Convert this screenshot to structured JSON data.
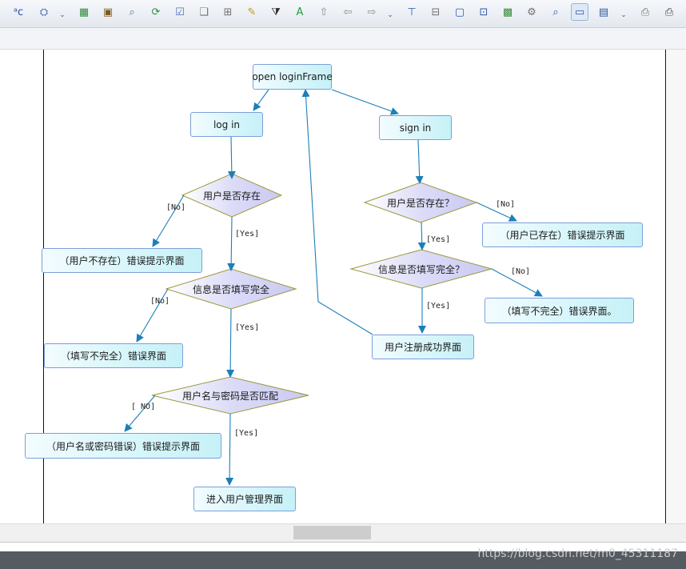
{
  "toolbar": {
    "buttons": [
      {
        "icon": "spell-check-icon",
        "glyph": "ᵃc",
        "color": "#2747a8"
      },
      {
        "icon": "shield-gear-icon",
        "glyph": "⛭",
        "color": "#4a6cb8"
      },
      {
        "icon": "notebook-icon",
        "glyph": "▦",
        "color": "#2f8a3a"
      },
      {
        "icon": "briefcase-icon",
        "glyph": "▣",
        "color": "#7a5a1e"
      },
      {
        "icon": "find-replace-icon",
        "glyph": "⌕",
        "color": "#5a6f9a"
      },
      {
        "icon": "refresh-icon",
        "glyph": "⟳",
        "color": "#2a8f3a"
      },
      {
        "icon": "checklist-icon",
        "glyph": "☑",
        "color": "#4a6cb8"
      },
      {
        "icon": "shadow-box-icon",
        "glyph": "❏",
        "color": "#707070"
      },
      {
        "icon": "align-grid-icon",
        "glyph": "⊞",
        "color": "#707070"
      },
      {
        "icon": "pencil-icon",
        "glyph": "✎",
        "color": "#c9961c"
      },
      {
        "icon": "paint-bucket-icon",
        "glyph": "⧩",
        "color": "#2e2e2e"
      },
      {
        "icon": "font-color-icon",
        "glyph": "A",
        "color": "#1f9e3a"
      },
      {
        "icon": "export-icon",
        "glyph": "⇧",
        "color": "#8a8a8a"
      },
      {
        "icon": "back-arrow-icon",
        "glyph": "⇦",
        "color": "#8a8a8a"
      },
      {
        "icon": "forward-arrow-icon",
        "glyph": "⇨",
        "color": "#8a8a8a"
      },
      {
        "icon": "class-diagram-icon",
        "glyph": "⊤",
        "color": "#2d55a6"
      },
      {
        "icon": "layout-icon",
        "glyph": "⊟",
        "color": "#707070"
      },
      {
        "icon": "page-icon",
        "glyph": "▢",
        "color": "#2d55a6"
      },
      {
        "icon": "component-icon",
        "glyph": "⊡",
        "color": "#2d55a6"
      },
      {
        "icon": "image-icon",
        "glyph": "▩",
        "color": "#3a8a3a"
      },
      {
        "icon": "settings-page-icon",
        "glyph": "⚙",
        "color": "#707070"
      },
      {
        "icon": "zoom-page-icon",
        "glyph": "⌕",
        "color": "#2d55a6"
      },
      {
        "icon": "comment-icon",
        "glyph": "▭",
        "color": "#2d55a6",
        "active": true
      },
      {
        "icon": "table-icon",
        "glyph": "▤",
        "color": "#2d55a6"
      },
      {
        "icon": "print-preview-icon",
        "glyph": "⎙",
        "color": "#707070"
      },
      {
        "icon": "printer-icon",
        "glyph": "⎙",
        "color": "#404040"
      }
    ],
    "overflow_glyph": "⌄"
  },
  "diagram": {
    "nodes": {
      "open_login": "open loginFrame",
      "log_in": "log in",
      "sign_in": "sign in",
      "user_not_exist_error": "（用户不存在）错误提示界面",
      "login_incomplete_error": "（填写不完全）错误界面",
      "credentials_error": "（用户名或密码错误）错误提示界面",
      "enter_admin": "进入用户管理界面",
      "user_exists_error": "（用户已存在）错误提示界面",
      "signup_incomplete_error": "（填写不完全）错误界面。",
      "register_success": "用户注册成功界面"
    },
    "decisions": {
      "login_user_exists": "用户是否存在",
      "login_info_complete": "信息是否填写完全",
      "credentials_match": "用户名与密码是否匹配",
      "signup_user_exists": "用户是否存在？",
      "signup_info_complete": "信息是否填写完全？"
    },
    "guards": {
      "no_1": "[No]",
      "yes_1": "[Yes]",
      "no_2": "[No]",
      "yes_2": "[Yes]",
      "no_3": "[ NO]",
      "yes_3": "[Yes]",
      "no_4": "[No]",
      "yes_4": "[Yes]",
      "no_5": "[No]",
      "yes_5": "[Yes]"
    },
    "colors": {
      "edge": "#1c7fb8",
      "node_border": "#7d9fd8",
      "node_fill": "#d8f6fb",
      "decision_fill": "#dcdcf8",
      "decision_border": "#9c9a3c"
    }
  },
  "scrollbar": {
    "position": 0.43
  },
  "watermark": "https://blog.csdn.net/m0_45311187"
}
